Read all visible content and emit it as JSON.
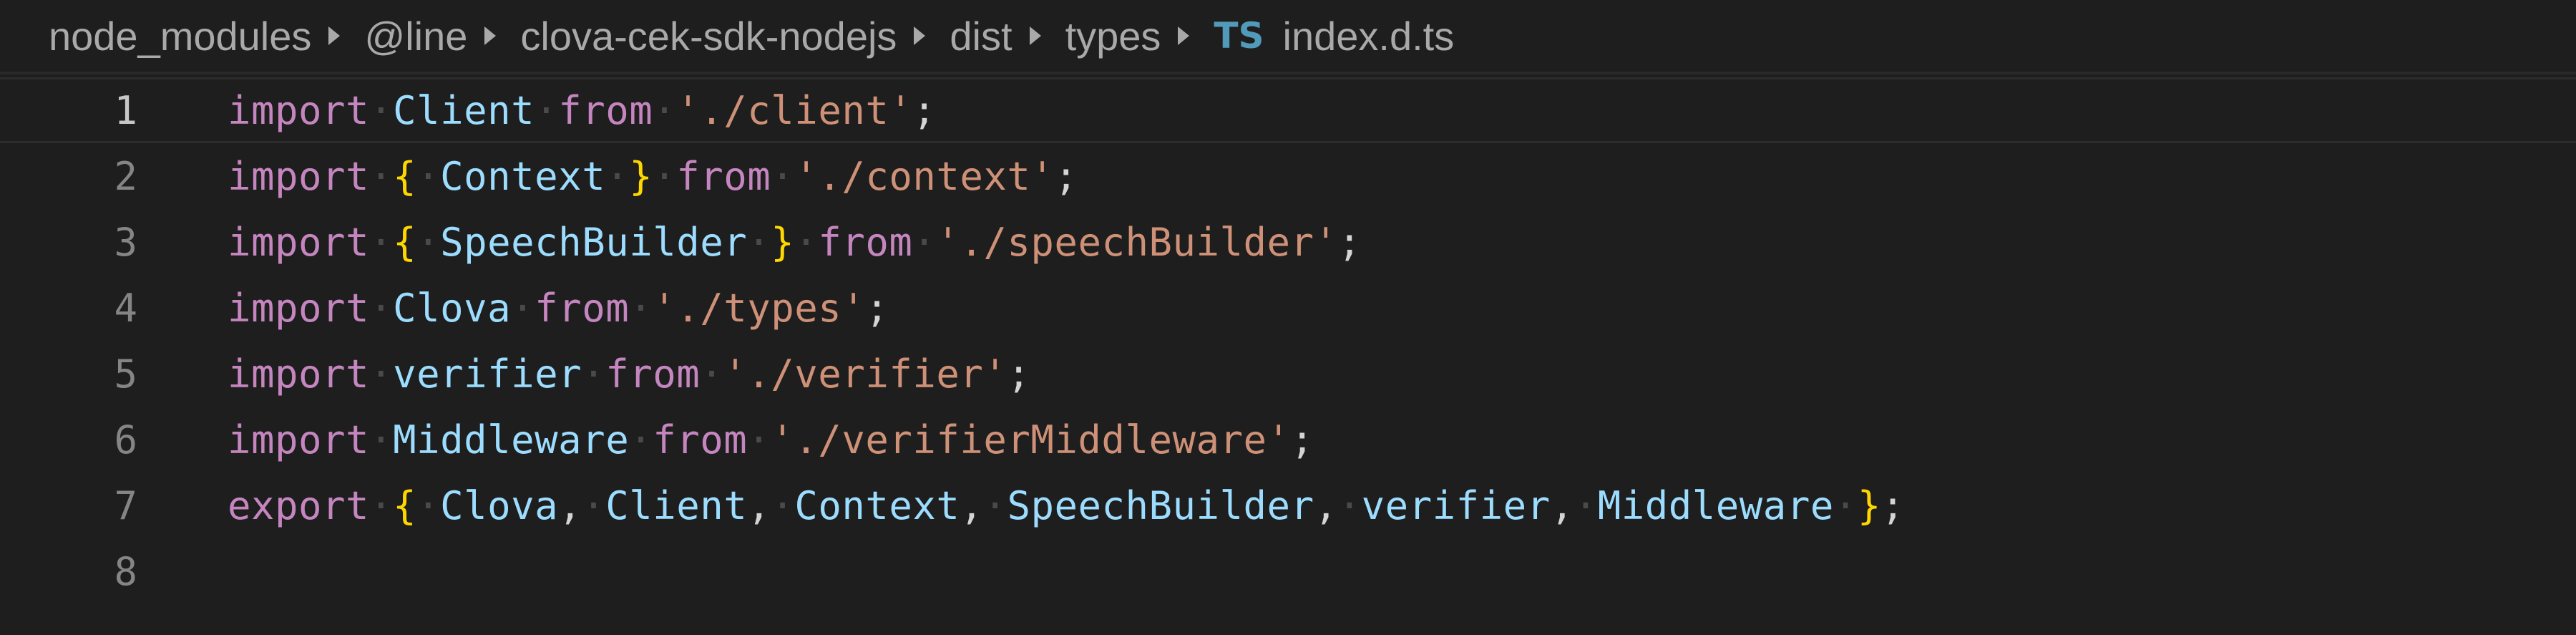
{
  "breadcrumb": {
    "segments": [
      "node_modules",
      "@line",
      "clova-cek-sdk-nodejs",
      "dist",
      "types"
    ],
    "file_badge": "TS",
    "file_name": "index.d.ts"
  },
  "editor": {
    "current_line": 1,
    "colors": {
      "keyword": "#c586c0",
      "identifier": "#9cdcfe",
      "string": "#ce9178",
      "brace": "#ffd700",
      "punctuation": "#d4d4d4",
      "whitespace_marker": "#4a4a4a",
      "line_number": "#858585",
      "background": "#1e1e1e"
    },
    "lines": [
      {
        "number": "1",
        "tokens": [
          [
            "kw",
            "import"
          ],
          [
            "ws",
            "·"
          ],
          [
            "id",
            "Client"
          ],
          [
            "ws",
            "·"
          ],
          [
            "kw",
            "from"
          ],
          [
            "ws",
            "·"
          ],
          [
            "str",
            "'./client'"
          ],
          [
            "punc",
            ";"
          ]
        ]
      },
      {
        "number": "2",
        "tokens": [
          [
            "kw",
            "import"
          ],
          [
            "ws",
            "·"
          ],
          [
            "brace",
            "{"
          ],
          [
            "ws",
            "·"
          ],
          [
            "id",
            "Context"
          ],
          [
            "ws",
            "·"
          ],
          [
            "brace",
            "}"
          ],
          [
            "ws",
            "·"
          ],
          [
            "kw",
            "from"
          ],
          [
            "ws",
            "·"
          ],
          [
            "str",
            "'./context'"
          ],
          [
            "punc",
            ";"
          ]
        ]
      },
      {
        "number": "3",
        "tokens": [
          [
            "kw",
            "import"
          ],
          [
            "ws",
            "·"
          ],
          [
            "brace",
            "{"
          ],
          [
            "ws",
            "·"
          ],
          [
            "id",
            "SpeechBuilder"
          ],
          [
            "ws",
            "·"
          ],
          [
            "brace",
            "}"
          ],
          [
            "ws",
            "·"
          ],
          [
            "kw",
            "from"
          ],
          [
            "ws",
            "·"
          ],
          [
            "str",
            "'./speechBuilder'"
          ],
          [
            "punc",
            ";"
          ]
        ]
      },
      {
        "number": "4",
        "tokens": [
          [
            "kw",
            "import"
          ],
          [
            "ws",
            "·"
          ],
          [
            "id",
            "Clova"
          ],
          [
            "ws",
            "·"
          ],
          [
            "kw",
            "from"
          ],
          [
            "ws",
            "·"
          ],
          [
            "str",
            "'./types'"
          ],
          [
            "punc",
            ";"
          ]
        ]
      },
      {
        "number": "5",
        "tokens": [
          [
            "kw",
            "import"
          ],
          [
            "ws",
            "·"
          ],
          [
            "id",
            "verifier"
          ],
          [
            "ws",
            "·"
          ],
          [
            "kw",
            "from"
          ],
          [
            "ws",
            "·"
          ],
          [
            "str",
            "'./verifier'"
          ],
          [
            "punc",
            ";"
          ]
        ]
      },
      {
        "number": "6",
        "tokens": [
          [
            "kw",
            "import"
          ],
          [
            "ws",
            "·"
          ],
          [
            "id",
            "Middleware"
          ],
          [
            "ws",
            "·"
          ],
          [
            "kw",
            "from"
          ],
          [
            "ws",
            "·"
          ],
          [
            "str",
            "'./verifierMiddleware'"
          ],
          [
            "punc",
            ";"
          ]
        ]
      },
      {
        "number": "7",
        "tokens": [
          [
            "kw",
            "export"
          ],
          [
            "ws",
            "·"
          ],
          [
            "brace",
            "{"
          ],
          [
            "ws",
            "·"
          ],
          [
            "id",
            "Clova"
          ],
          [
            "punc",
            ","
          ],
          [
            "ws",
            "·"
          ],
          [
            "id",
            "Client"
          ],
          [
            "punc",
            ","
          ],
          [
            "ws",
            "·"
          ],
          [
            "id",
            "Context"
          ],
          [
            "punc",
            ","
          ],
          [
            "ws",
            "·"
          ],
          [
            "id",
            "SpeechBuilder"
          ],
          [
            "punc",
            ","
          ],
          [
            "ws",
            "·"
          ],
          [
            "id",
            "verifier"
          ],
          [
            "punc",
            ","
          ],
          [
            "ws",
            "·"
          ],
          [
            "id",
            "Middleware"
          ],
          [
            "ws",
            "·"
          ],
          [
            "brace",
            "}"
          ],
          [
            "punc",
            ";"
          ]
        ]
      },
      {
        "number": "8",
        "tokens": []
      }
    ]
  }
}
